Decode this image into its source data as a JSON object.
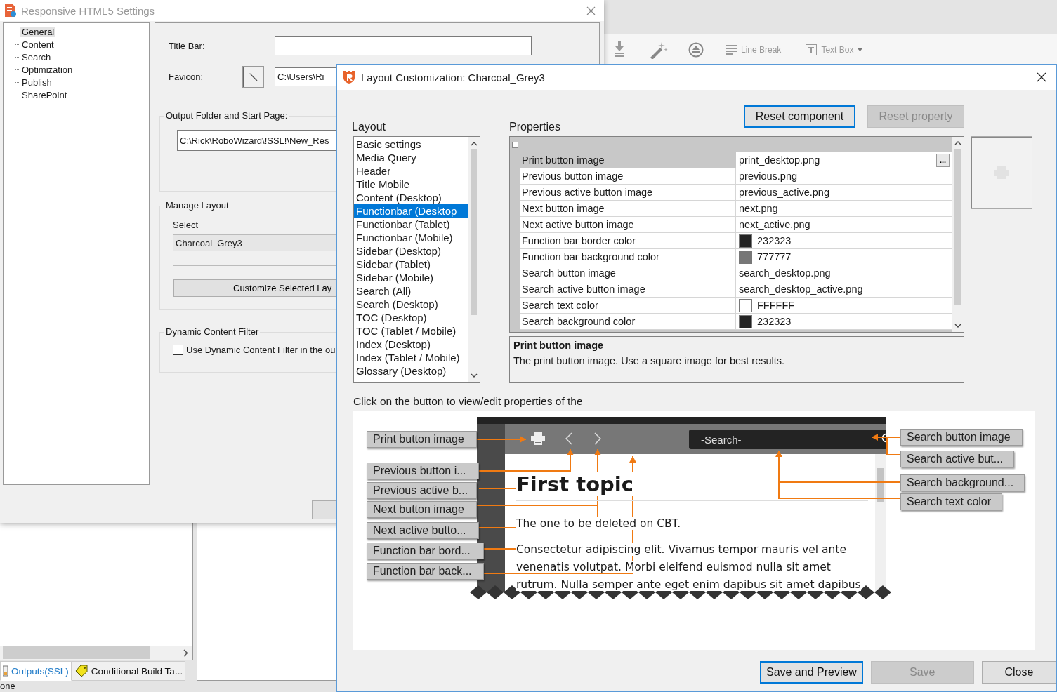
{
  "background_app": {
    "toolbar_items": [
      "Line Break",
      "Text Box"
    ],
    "bottom_tabs": [
      {
        "label": "Outputs(SSL)",
        "selected": true
      },
      {
        "label": "Conditional Build Ta...",
        "selected": false
      }
    ],
    "status_text": "one"
  },
  "settings_dialog": {
    "title": "Responsive HTML5 Settings",
    "tree": [
      {
        "label": "General",
        "selected": true
      },
      {
        "label": "Content",
        "selected": false
      },
      {
        "label": "Search",
        "selected": false
      },
      {
        "label": "Optimization",
        "selected": false
      },
      {
        "label": "Publish",
        "selected": false
      },
      {
        "label": "SharePoint",
        "selected": false
      }
    ],
    "title_bar": {
      "label": "Title Bar:"
    },
    "favicon": {
      "label": "Favicon:",
      "value": "C:\\Users\\Ri"
    },
    "output": {
      "heading": "Output Folder and Start Page:",
      "value": "C:\\Rick\\RoboWizard\\!SSL!\\New_Res"
    },
    "manage_layout": {
      "heading": "Manage Layout",
      "select_label": "Select",
      "select_value": "Charcoal_Grey3",
      "customize_button": "Customize Selected Lay"
    },
    "dynamic_filter": {
      "heading": "Dynamic Content Filter",
      "checkbox_label": "Use Dynamic Content Filter in the ou",
      "checked": false
    }
  },
  "layout_dialog": {
    "title": "Layout Customization: Charcoal_Grey3",
    "layout_heading": "Layout",
    "properties_heading": "Properties",
    "reset_buttons": [
      {
        "label": "Reset component",
        "disabled": false
      },
      {
        "label": "Reset property",
        "disabled": true
      }
    ],
    "layout_items": [
      {
        "label": "Basic settings",
        "selected": false
      },
      {
        "label": "Media Query",
        "selected": false
      },
      {
        "label": "Header",
        "selected": false
      },
      {
        "label": "Title Mobile",
        "selected": false
      },
      {
        "label": "Content (Desktop)",
        "selected": false
      },
      {
        "label": "Functionbar (Desktop",
        "selected": true
      },
      {
        "label": "Functionbar (Tablet)",
        "selected": false
      },
      {
        "label": "Functionbar (Mobile)",
        "selected": false
      },
      {
        "label": "Sidebar (Desktop)",
        "selected": false
      },
      {
        "label": "Sidebar (Tablet)",
        "selected": false
      },
      {
        "label": "Sidebar (Mobile)",
        "selected": false
      },
      {
        "label": "Search (All)",
        "selected": false
      },
      {
        "label": "Search (Desktop)",
        "selected": false
      },
      {
        "label": "TOC (Desktop)",
        "selected": false
      },
      {
        "label": "TOC (Tablet / Mobile)",
        "selected": false
      },
      {
        "label": "Index (Desktop)",
        "selected": false
      },
      {
        "label": "Index (Tablet / Mobile)",
        "selected": false
      },
      {
        "label": "Glossary (Desktop)",
        "selected": false
      }
    ],
    "properties": [
      {
        "name": "Print button image",
        "value": "print_desktop.png",
        "kind": "file",
        "selected": true
      },
      {
        "name": "Previous button image",
        "value": "previous.png",
        "kind": "file",
        "selected": false
      },
      {
        "name": "Previous active button image",
        "value": "previous_active.png",
        "kind": "file",
        "selected": false
      },
      {
        "name": "Next button image",
        "value": "next.png",
        "kind": "file",
        "selected": false
      },
      {
        "name": "Next active button image",
        "value": "next_active.png",
        "kind": "file",
        "selected": false
      },
      {
        "name": "Function bar border color",
        "value": "232323",
        "kind": "color",
        "color": "#232323",
        "selected": false
      },
      {
        "name": "Function bar background color",
        "value": "777777",
        "kind": "color",
        "color": "#777777",
        "selected": false
      },
      {
        "name": "Search button image",
        "value": "search_desktop.png",
        "kind": "file",
        "selected": false
      },
      {
        "name": "Search active button image",
        "value": "search_desktop_active.png",
        "kind": "file",
        "selected": false
      },
      {
        "name": "Search text color",
        "value": "FFFFFF",
        "kind": "color",
        "color": "#ffffff",
        "selected": false
      },
      {
        "name": "Search background color",
        "value": "232323",
        "kind": "color",
        "color": "#232323",
        "selected": false
      }
    ],
    "browse_button": "...",
    "description": {
      "title": "Print button image",
      "text": "The print button image. Use a square image for best results."
    },
    "hint": "Click on the button to view/edit properties of the",
    "preview": {
      "search_placeholder": "-Search-",
      "heading": "First topic",
      "paragraphs": [
        "The one to be deleted on CBT.",
        "Consectetur adipiscing elit. Vivamus tempor mauris vel ante venenatis volutpat. Morbi eleifend euismod nulla sit amet rutrum. Nulla semper ante eget enim dapibus sit amet dapibus"
      ],
      "callouts": [
        {
          "label": "Print button image"
        },
        {
          "label": "Previous button i..."
        },
        {
          "label": "Previous active b..."
        },
        {
          "label": "Next button image"
        },
        {
          "label": "Next active butto..."
        },
        {
          "label": "Function bar bord..."
        },
        {
          "label": "Function bar back..."
        },
        {
          "label": "Search button image"
        },
        {
          "label": "Search active but..."
        },
        {
          "label": "Search background..."
        },
        {
          "label": "Search text color"
        }
      ]
    },
    "buttons": [
      {
        "label": "Save and Preview",
        "disabled": false,
        "default": true
      },
      {
        "label": "Save",
        "disabled": true,
        "default": false
      },
      {
        "label": "Close",
        "disabled": false,
        "default": false
      }
    ]
  }
}
